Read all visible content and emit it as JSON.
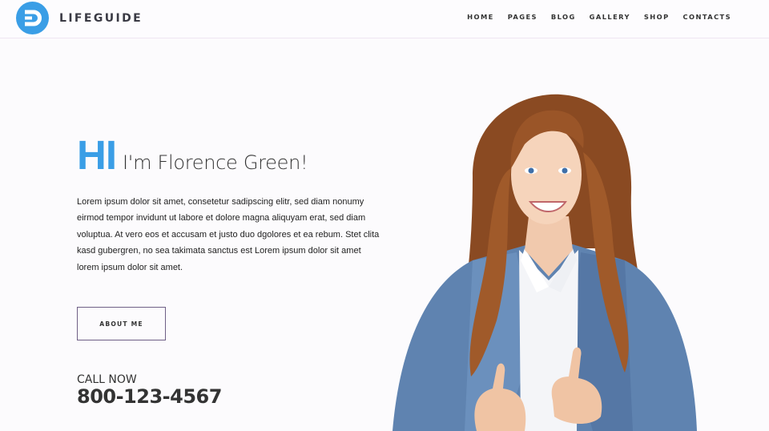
{
  "brand": {
    "name": "LIFEGUIDE",
    "logo_color": "#3a9ee6"
  },
  "nav": {
    "items": [
      "HOME",
      "PAGES",
      "BLOG",
      "GALLERY",
      "SHOP",
      "CONTACTS"
    ]
  },
  "hero": {
    "greeting": "HI",
    "name": "I'm Florence Green!",
    "bio": "Lorem ipsum dolor sit amet, consetetur sadipscing elitr, sed diam nonumy eirmod tempor invidunt ut labore et dolore magna aliquyam erat, sed diam voluptua. At vero eos et accusam et justo duo dgolores et ea rebum. Stet clita kasd gubergren, no sea takimata sanctus est Lorem ipsum dolor sit amet lorem ipsum dolor sit amet.",
    "button_label": "ABOUT ME",
    "call_label": "CALL NOW",
    "phone": "800-123-4567",
    "accent_color": "#3a9ee6"
  }
}
